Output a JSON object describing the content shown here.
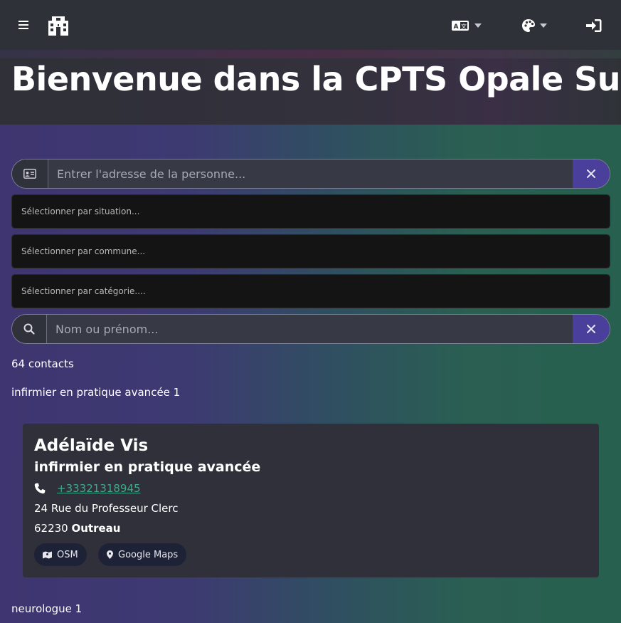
{
  "nav": {
    "menu_icon": "hamburger-icon",
    "logo_icon": "building-icon",
    "translate_icon": "translate-icon",
    "theme_icon": "palette-icon",
    "login_icon": "sign-in-icon"
  },
  "hero": {
    "title": "Bienvenue dans la CPTS Opale Sud!"
  },
  "filters": {
    "address_placeholder": "Entrer l'adresse de la personne...",
    "situation_placeholder": "Sélectionner par situation...",
    "commune_placeholder": "Sélectionner par commune...",
    "category_placeholder": "Sélectionner par catégorie....",
    "name_placeholder": "Nom ou prénom..."
  },
  "results": {
    "count": "64 contacts",
    "group1": "infirmier en pratique avancée 1",
    "group2": "neurologue 1"
  },
  "card": {
    "name": "Adélaïde Vis",
    "role": "infirmier en pratique avancée",
    "phone": "+33321318945",
    "street": "24 Rue du Professeur Clerc",
    "postcode": "62230",
    "city": "Outreau",
    "osm_label": "OSM",
    "gmaps_label": "Google Maps"
  },
  "colors": {
    "accent": "#4a3f9a",
    "link": "#3fa98a",
    "navbar": "#2f3138",
    "card": "#2f3039"
  }
}
